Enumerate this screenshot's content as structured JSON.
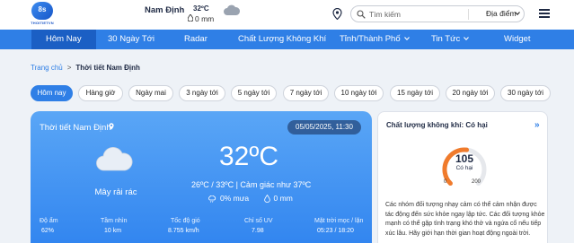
{
  "header": {
    "brand": "THOITIETVN",
    "logo_text": "8s",
    "location": "Nam Định",
    "temp": "32ºC",
    "rain": "0 mm",
    "search_placeholder": "Tìm kiếm",
    "select_label": "Địa điểm"
  },
  "nav": {
    "items": [
      "Hôm Nay",
      "30 Ngày Tới",
      "Radar",
      "Chất Lượng Không Khí",
      "Tỉnh/Thành Phố",
      "Tin Tức",
      "Widget"
    ]
  },
  "breadcrumb": {
    "home": "Trang chủ",
    "separator": ">",
    "current": "Thời tiết Nam Định"
  },
  "tabs": [
    "Hôm nay",
    "Hàng giờ",
    "Ngày mai",
    "3 ngày tới",
    "5 ngày tới",
    "7 ngày tới",
    "10 ngày tới",
    "15 ngày tới",
    "20 ngày tới",
    "30 ngày tới"
  ],
  "weather": {
    "title": "Thời tiết Nam Định",
    "datetime": "05/05/2025, 11:30",
    "condition": "Mây rải rác",
    "temp": "32ºC",
    "range_feel": "26ºC / 33ºC | Cảm giác như 37ºC",
    "rain_pct": "0% mưa",
    "rain_mm": "0 mm",
    "stats": [
      {
        "label": "Độ ẩm",
        "value": "62%"
      },
      {
        "label": "Tầm nhìn",
        "value": "10 km"
      },
      {
        "label": "Tốc độ gió",
        "value": "8.755 km/h"
      },
      {
        "label": "Chỉ số UV",
        "value": "7.98"
      },
      {
        "label": "Mặt trời mọc / lặn",
        "value": "05:23  /  18:20"
      }
    ]
  },
  "aqi": {
    "title": "Chất lượng không khí: Có hại",
    "arrow": "»",
    "value": "105",
    "level": "Có hại",
    "min": "0",
    "max": "200",
    "fraction": 0.525,
    "desc": "Các nhóm đối tượng nhạy cảm có thể cảm nhận được tác động đến sức khỏe ngay lập tức. Các đối tượng khỏe mạnh có thể gặp tình trạng khó thở và ngứa cổ nếu tiếp xúc lâu. Hãy giới hạn thời gian hoạt động ngoài trời.",
    "colors": {
      "track": "#e6e8ec",
      "arc": "#f07b2c"
    }
  },
  "colors": {
    "accent": "#2f7fe6",
    "nav_active": "#1b5fc4"
  }
}
